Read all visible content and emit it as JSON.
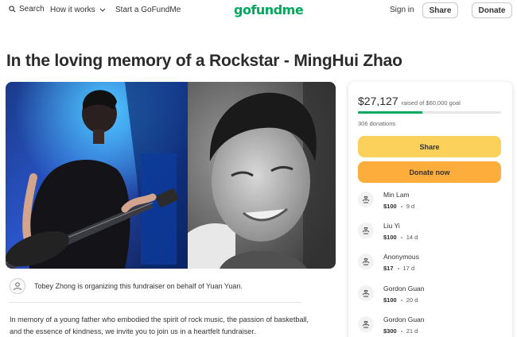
{
  "nav": {
    "search": "Search",
    "how_it_works": "How it works",
    "start": "Start a GoFundMe",
    "logo": "gofundme",
    "signin": "Sign in",
    "share": "Share",
    "donate": "Donate"
  },
  "campaign": {
    "title": "In the loving memory of a Rockstar - MingHui Zhao",
    "organizer_text": "Tobey Zhong is organizing this fundraiser on behalf of Yuan Yuan.",
    "story": "In memory of a young father who embodied the spirit of rock music, the passion of basketball, and the essence of kindness, we invite you to join us in a heartfelt fundraiser."
  },
  "card": {
    "raised": "$27,127",
    "goal_text": "raised of $60,000 goal",
    "progress_fraction": 0.452,
    "donations_count": "306 donations",
    "share_label": "Share",
    "donate_label": "Donate now"
  },
  "donors": [
    {
      "name": "Min Lam",
      "amount": "$100",
      "time": "9 d"
    },
    {
      "name": "Liu Yi",
      "amount": "$100",
      "time": "14 d"
    },
    {
      "name": "Anonymous",
      "amount": "$17",
      "time": "17 d"
    },
    {
      "name": "Gordon Guan",
      "amount": "$100",
      "time": "20 d"
    },
    {
      "name": "Gordon Guan",
      "amount": "$300",
      "time": "21 d"
    }
  ],
  "colors": {
    "brand": "#02a95c",
    "share_button": "#fbd15b",
    "donate_button": "#fcad3b"
  },
  "icons": [
    "search-icon",
    "chevron-down-icon",
    "user-icon",
    "donation-hands-icon"
  ]
}
